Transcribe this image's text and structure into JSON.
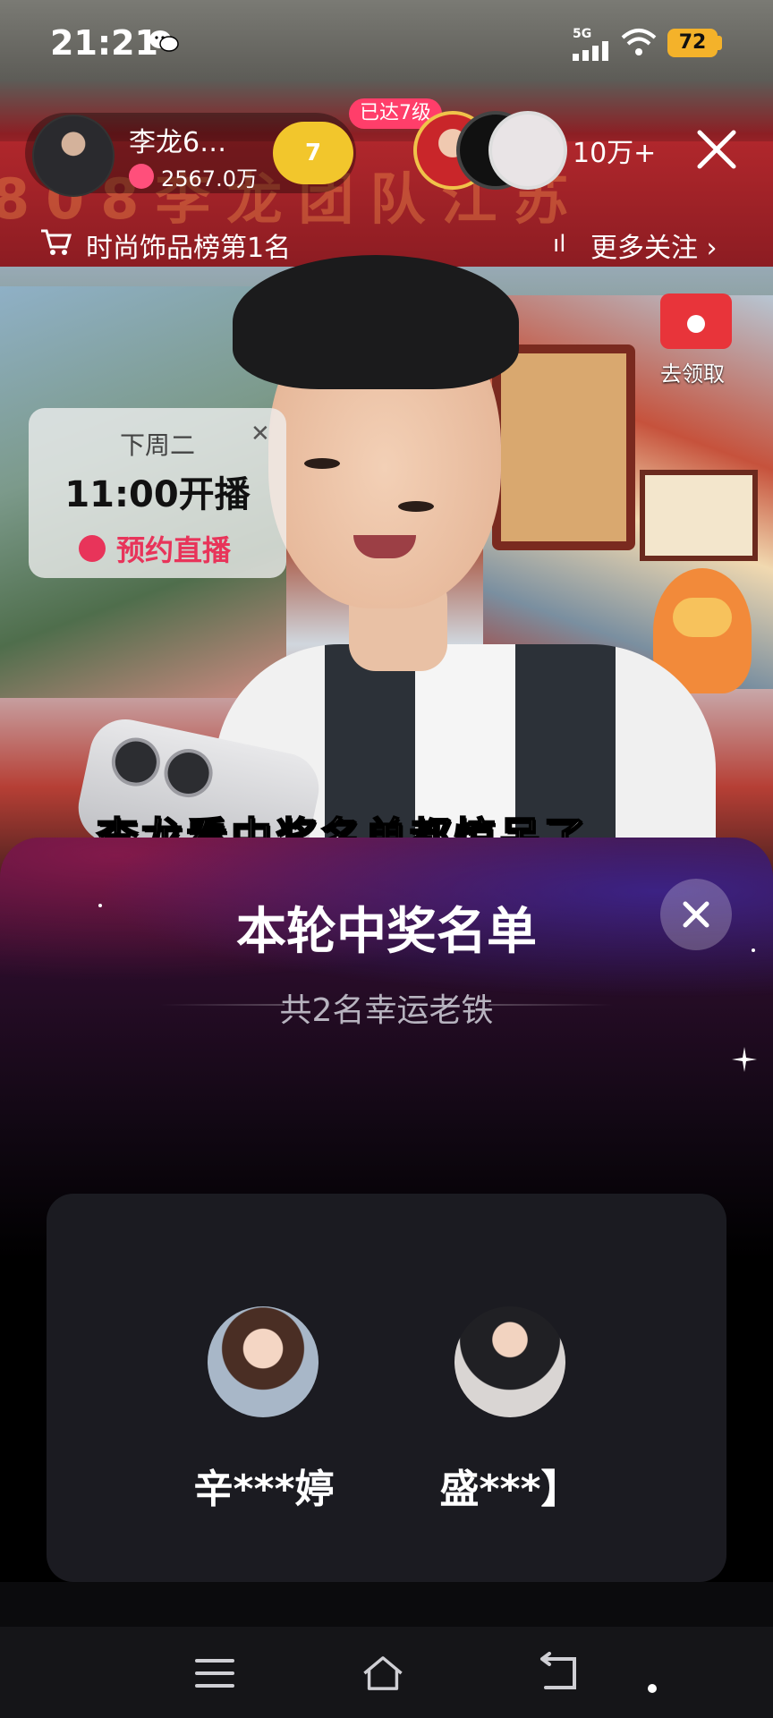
{
  "status_bar": {
    "time": "21:21",
    "network": "5G",
    "battery": "72",
    "icons": [
      "wechat-icon",
      "signal-icon",
      "wifi-icon",
      "battery-icon"
    ]
  },
  "host": {
    "name": "李龙6…",
    "fans": "2567.0万",
    "level": "7",
    "level_tag": "已达7级"
  },
  "viewers": {
    "count": "10万+"
  },
  "rank": {
    "label": "时尚饰品榜第1名",
    "more_follow": "更多关注"
  },
  "claim": {
    "label": "去领取"
  },
  "background_banner": {
    "text": "808李龙团队江苏"
  },
  "reservation": {
    "day": "下周二",
    "time": "11:00开播",
    "button": "预约直播"
  },
  "caption": "李龙看中奖名单都惊呆了",
  "winner_panel": {
    "title": "本轮中奖名单",
    "subtitle": "共2名幸运老铁",
    "winners": [
      {
        "name": "辛***婷"
      },
      {
        "name": "盛***】"
      }
    ]
  },
  "colors": {
    "accent_pink": "#ff3e6a",
    "badge_gold": "#f2c62c",
    "battery": "#f4b22a",
    "panel_card": "#1b1b21"
  },
  "navbar": {
    "icons": [
      "menu-icon",
      "home-icon",
      "back-icon"
    ]
  }
}
